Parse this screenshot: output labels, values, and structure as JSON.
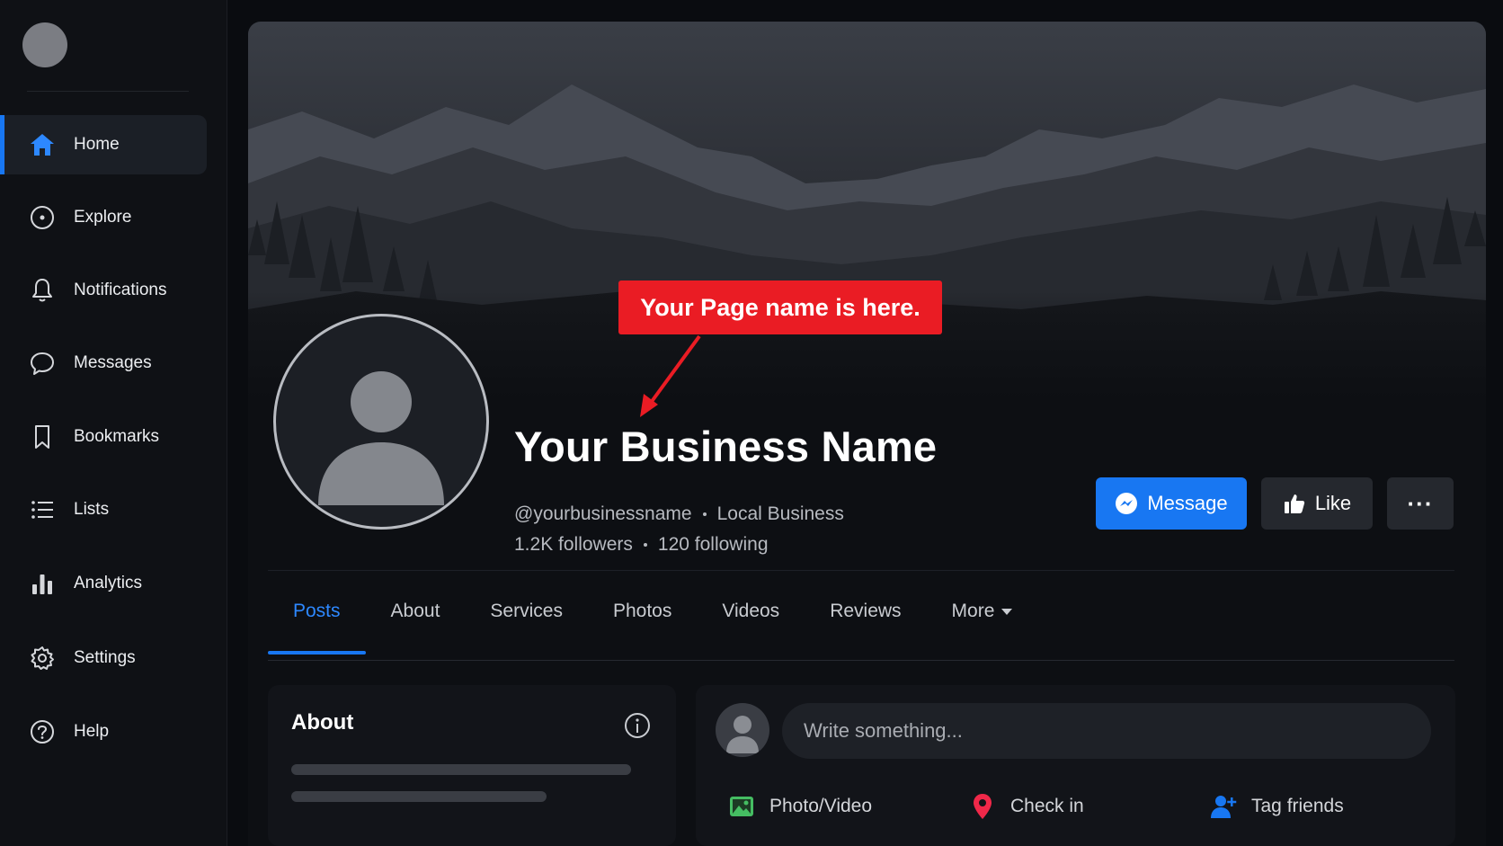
{
  "sidebar": {
    "items": [
      {
        "label": "Home",
        "icon": "home-icon",
        "active": true
      },
      {
        "label": "Explore",
        "icon": "compass-icon"
      },
      {
        "label": "Notifications",
        "icon": "bell-icon"
      },
      {
        "label": "Messages",
        "icon": "chat-bubble-icon"
      },
      {
        "label": "Bookmarks",
        "icon": "bookmark-icon"
      },
      {
        "label": "Lists",
        "icon": "list-icon"
      },
      {
        "label": "Analytics",
        "icon": "bar-chart-icon"
      },
      {
        "label": "Settings",
        "icon": "gear-icon"
      },
      {
        "label": "Help",
        "icon": "question-icon"
      }
    ]
  },
  "callout": {
    "text": "Your Page name is here.",
    "color": "#ea1c24"
  },
  "profile": {
    "name": "Your Business Name",
    "handle": "@yourbusinessname",
    "category": "Local Business",
    "followers": "1.2K followers",
    "following": "120 following"
  },
  "actions": {
    "message_label": "Message",
    "like_label": "Like",
    "more_label": "···"
  },
  "tabs": [
    "Posts",
    "About",
    "Services",
    "Photos",
    "Videos",
    "Reviews",
    "More"
  ],
  "about_card": {
    "title": "About"
  },
  "composer": {
    "placeholder": "Write something...",
    "actions": [
      {
        "label": "Photo/Video",
        "icon": "photo-icon"
      },
      {
        "label": "Check in",
        "icon": "location-pin-icon"
      },
      {
        "label": "Tag friends",
        "icon": "tag-friends-icon"
      }
    ]
  },
  "colors": {
    "accent": "#1877f2",
    "background": "#0a0c10",
    "callout": "#ea1c24"
  }
}
